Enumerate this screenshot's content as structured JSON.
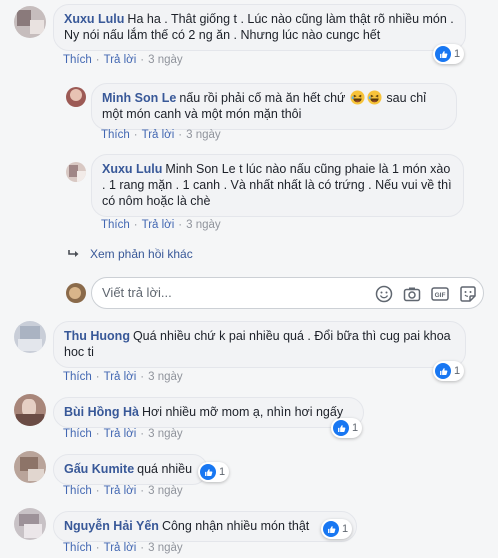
{
  "comments": [
    {
      "name": "Xuxu Lulu",
      "text": "Ha ha . Thât giống t . Lúc nào cũng làm thật rõ nhiều món . Ny nói nấu lắm thế có 2 ng ăn . Nhưng lúc nào cungc hết",
      "like": "Thích",
      "reply": "Trả lời",
      "time": "3 ngày",
      "reactions": "1"
    },
    {
      "name": "Minh Son Le",
      "text_a": "nấu rồi phải cố mà ăn hết chứ",
      "text_b": "sau chỉ một món canh và một món mặn thôi",
      "like": "Thích",
      "reply": "Trả lời",
      "time": "3 ngày"
    },
    {
      "name": "Xuxu Lulu",
      "text": "Minh Son Le t lúc nào nấu cũng phaie là 1 món xào . 1 rang mặn . 1 canh . Và nhất nhất là có trứng . Nếu vui về thì có nôm hoặc là chè",
      "like": "Thích",
      "reply": "Trả lời",
      "time": "3 ngày"
    },
    {
      "name": "Thu Huong",
      "text": "Quá nhiều chứ k pai nhiều quá . Đổi bữa thì cug pai khoa hoc ti",
      "like": "Thích",
      "reply": "Trả lời",
      "time": "3 ngày",
      "reactions": "1"
    },
    {
      "name": "Bùi Hồng Hà",
      "text": "Hơi nhiều mỡ mom ạ, nhìn hơi ngấy",
      "like": "Thích",
      "reply": "Trả lời",
      "time": "3 ngày",
      "reactions": "1"
    },
    {
      "name": "Gấu Kumite",
      "text": "quá nhiều",
      "like": "Thích",
      "reply": "Trả lời",
      "time": "3 ngày",
      "reactions": "1"
    },
    {
      "name": "Nguyễn Hải Yến",
      "text": "Công nhận nhiều món thật",
      "like": "Thích",
      "reply": "Trả lời",
      "time": "3 ngày",
      "reactions": "1"
    }
  ],
  "more_replies": "Xem phản hồi khác",
  "composer": {
    "placeholder": "Viết trả lời..."
  },
  "icons": {
    "like": "thumbs-up-icon",
    "emoji": "laughing-emoji-icon",
    "reply_arrow": "reply-arrow-icon",
    "smiley": "smiley-icon",
    "camera": "camera-icon",
    "gif": "gif-icon",
    "sticker": "sticker-icon"
  },
  "colors": {
    "name": "#385898",
    "action": "#4267b2",
    "muted": "#90949c",
    "like_badge": "#1877f2",
    "bubble": "#f2f3f5"
  }
}
